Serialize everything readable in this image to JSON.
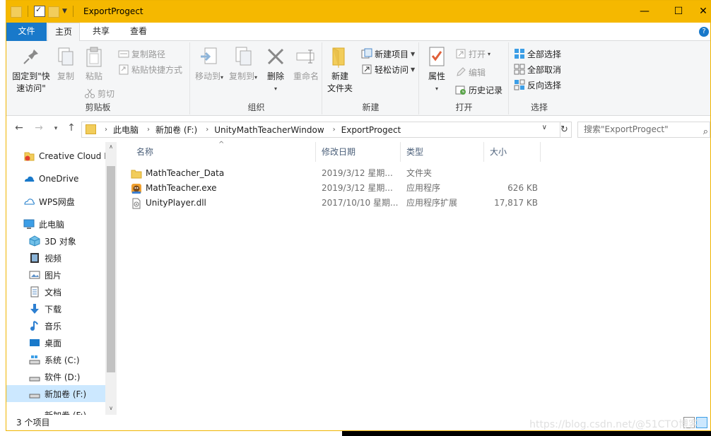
{
  "window": {
    "title": "ExportProgect",
    "controls": {
      "minimize": "—",
      "maximize": "☐",
      "close": "✕"
    }
  },
  "ribbon_tabs": {
    "file": "文件",
    "home": "主页",
    "share": "共享",
    "view": "查看"
  },
  "ribbon": {
    "clipboard": {
      "label": "剪贴板",
      "pin": "固定到\"快速访问\"",
      "pin_line1": "固定到\"快",
      "pin_line2": "速访问\"",
      "copy": "复制",
      "paste": "粘贴",
      "copy_path": "复制路径",
      "paste_shortcut": "粘贴快捷方式",
      "cut": "剪切"
    },
    "organize": {
      "label": "组织",
      "move_to": "移动到",
      "copy_to": "复制到",
      "delete": "删除",
      "rename": "重命名"
    },
    "new": {
      "label": "新建",
      "new_folder_line1": "新建",
      "new_folder_line2": "文件夹",
      "new_item": "新建项目",
      "easy_access": "轻松访问"
    },
    "open": {
      "label": "打开",
      "properties": "属性",
      "open": "打开",
      "edit": "编辑",
      "history": "历史记录"
    },
    "select": {
      "label": "选择",
      "select_all": "全部选择",
      "select_none": "全部取消",
      "invert": "反向选择"
    }
  },
  "address": {
    "crumbs": [
      "此电脑",
      "新加卷 (F:)",
      "UnityMathTeacherWindow",
      "ExportProgect"
    ],
    "search_placeholder": "搜索\"ExportProgect\""
  },
  "nav_pane": [
    {
      "label": "Creative Cloud F",
      "icon": "creative-cloud-icon"
    },
    {
      "label": "OneDrive",
      "icon": "onedrive-icon"
    },
    {
      "label": "WPS网盘",
      "icon": "wps-cloud-icon"
    },
    {
      "label": "此电脑",
      "icon": "this-pc-icon"
    },
    {
      "label": "3D 对象",
      "icon": "3d-objects-icon"
    },
    {
      "label": "视频",
      "icon": "video-icon"
    },
    {
      "label": "图片",
      "icon": "pictures-icon"
    },
    {
      "label": "文档",
      "icon": "documents-icon"
    },
    {
      "label": "下载",
      "icon": "download-icon"
    },
    {
      "label": "音乐",
      "icon": "music-icon"
    },
    {
      "label": "桌面",
      "icon": "desktop-icon"
    },
    {
      "label": "系统 (C:)",
      "icon": "drive-icon"
    },
    {
      "label": "软件 (D:)",
      "icon": "drive-icon"
    },
    {
      "label": "新加卷 (F:)",
      "icon": "drive-icon",
      "selected": true
    },
    {
      "label": "新加卷 (F:)",
      "icon": "drive-icon"
    }
  ],
  "columns": {
    "name": "名称",
    "date": "修改日期",
    "type": "类型",
    "size": "大小"
  },
  "files": [
    {
      "name": "MathTeacher_Data",
      "date": "2019/3/12 星期...",
      "type": "文件夹",
      "size": "",
      "icon": "folder-icon"
    },
    {
      "name": "MathTeacher.exe",
      "date": "2019/3/12 星期...",
      "type": "应用程序",
      "size": "626 KB",
      "icon": "unity-app-icon"
    },
    {
      "name": "UnityPlayer.dll",
      "date": "2017/10/10 星期...",
      "type": "应用程序扩展",
      "size": "17,817 KB",
      "icon": "dll-file-icon"
    }
  ],
  "status": {
    "item_count": "3 个项目"
  },
  "watermark": "https://blog.csdn.net/@51CTO博客",
  "colors": {
    "title_bar": "#f5b800",
    "file_tab": "#1979ca",
    "selection": "#cce8ff"
  }
}
